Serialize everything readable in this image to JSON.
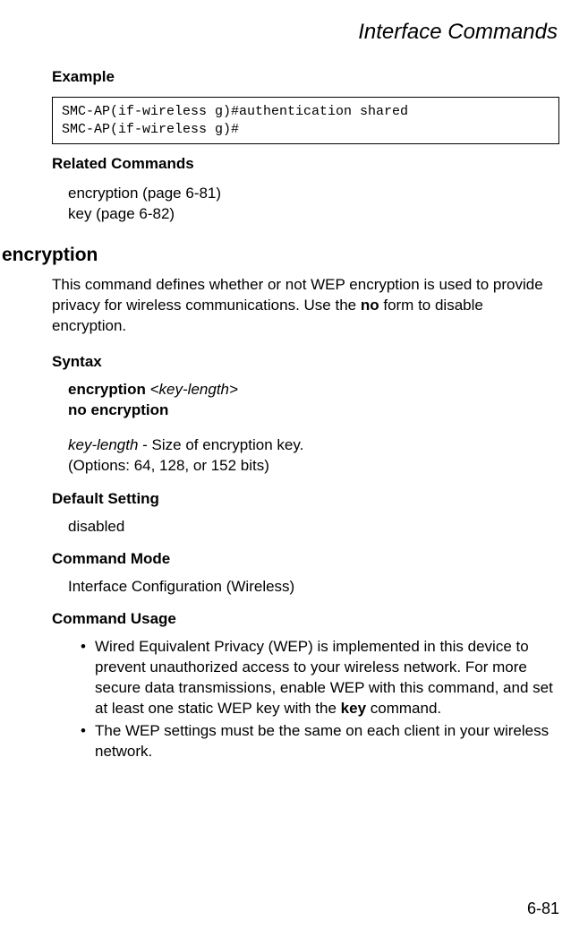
{
  "header": {
    "title": "Interface Commands"
  },
  "example": {
    "label": "Example",
    "code": "SMC-AP(if-wireless g)#authentication shared\nSMC-AP(if-wireless g)#"
  },
  "related": {
    "label": "Related Commands",
    "line1": "encryption (page 6-81)",
    "line2": "key (page 6-82)"
  },
  "command": {
    "name": "encryption",
    "desc_pre": "This command defines whether or not WEP encryption is used to provide privacy for wireless communications. Use the ",
    "desc_bold": "no",
    "desc_post": " form to disable encryption."
  },
  "syntax": {
    "label": "Syntax",
    "line1_bold": "encryption",
    "line1_italic": " <key-length>",
    "line2": "no encryption",
    "param_italic": "key-length",
    "param_text": " - Size of encryption key.",
    "param_options": "(Options: 64, 128, or 152 bits)"
  },
  "default": {
    "label": "Default Setting",
    "value": "disabled"
  },
  "mode": {
    "label": "Command Mode",
    "value": "Interface Configuration (Wireless)"
  },
  "usage": {
    "label": "Command Usage",
    "item1_pre": "Wired Equivalent Privacy (WEP) is implemented in this device to prevent unauthorized access to your wireless network. For more secure data transmissions, enable WEP with this command, and set at least one static WEP key with the ",
    "item1_bold": "key",
    "item1_post": " command.",
    "item2": "The WEP settings must be the same on each client in your wireless network."
  },
  "page": {
    "number": "6-81"
  }
}
